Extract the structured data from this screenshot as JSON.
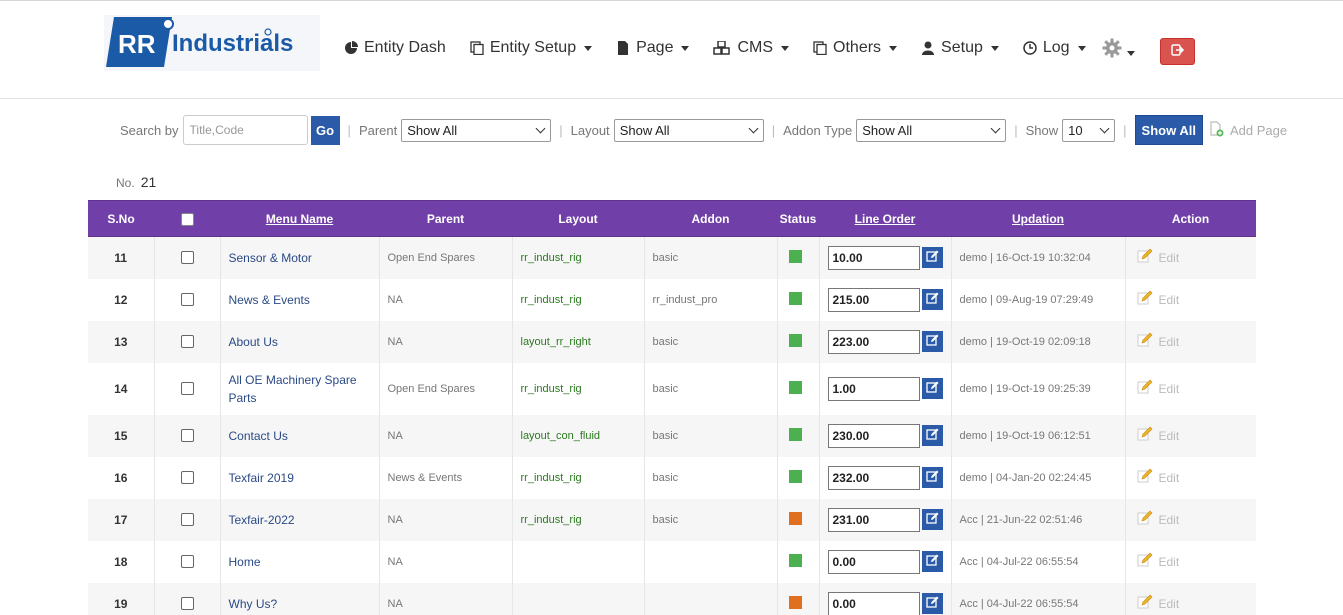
{
  "brand": {
    "logo_rr": "RR",
    "logo_text": "Industrials",
    "primary": "#1b5aa6"
  },
  "nav": [
    {
      "label": "Entity Dash",
      "icon": "pie-chart-icon",
      "caret": false
    },
    {
      "label": "Entity Setup",
      "icon": "copy-icon",
      "caret": true
    },
    {
      "label": "Page",
      "icon": "file-icon",
      "caret": true
    },
    {
      "label": "CMS",
      "icon": "cubes-icon",
      "caret": true
    },
    {
      "label": "Others",
      "icon": "copy-icon",
      "caret": true
    },
    {
      "label": "Setup",
      "icon": "user-icon",
      "caret": true
    },
    {
      "label": "Log",
      "icon": "clock-icon",
      "caret": true
    }
  ],
  "filters": {
    "search_label": "Search by",
    "search_placeholder": "Title,Code",
    "go_label": "Go",
    "parent_label": "Parent",
    "parent_value": "Show All",
    "layout_label": "Layout",
    "layout_value": "Show All",
    "addon_label": "Addon Type",
    "addon_value": "Show All",
    "show_label": "Show",
    "show_value": "10",
    "show_all_label": "Show All",
    "add_page_label": "Add Page"
  },
  "count": {
    "label": "No.",
    "value": "21"
  },
  "table": {
    "headers": {
      "sno": "S.No",
      "menu": "Menu Name",
      "parent": "Parent",
      "layout": "Layout",
      "addon": "Addon",
      "status": "Status",
      "order": "Line Order",
      "updation": "Updation",
      "action": "Action"
    },
    "edit_label": "Edit",
    "status_colors": {
      "active": "#4caf50",
      "inactive": "#e07020"
    },
    "rows": [
      {
        "sno": "11",
        "menu": "Sensor & Motor",
        "parent": "Open End Spares",
        "layout": "rr_indust_rig",
        "addon": "basic",
        "status": "active",
        "order": "10.00",
        "updation": "demo | 16-Oct-19 10:32:04"
      },
      {
        "sno": "12",
        "menu": "News & Events",
        "parent": "NA",
        "layout": "rr_indust_rig",
        "addon": "rr_indust_pro",
        "status": "active",
        "order": "215.00",
        "updation": "demo | 09-Aug-19 07:29:49"
      },
      {
        "sno": "13",
        "menu": "About Us",
        "parent": "NA",
        "layout": "layout_rr_right",
        "addon": "basic",
        "status": "active",
        "order": "223.00",
        "updation": "demo | 19-Oct-19 02:09:18"
      },
      {
        "sno": "14",
        "menu": "All OE Machinery Spare Parts",
        "parent": "Open End Spares",
        "layout": "rr_indust_rig",
        "addon": "basic",
        "status": "active",
        "order": "1.00",
        "updation": "demo | 19-Oct-19 09:25:39"
      },
      {
        "sno": "15",
        "menu": "Contact Us",
        "parent": "NA",
        "layout": "layout_con_fluid",
        "addon": "basic",
        "status": "active",
        "order": "230.00",
        "updation": "demo | 19-Oct-19 06:12:51"
      },
      {
        "sno": "16",
        "menu": "Texfair 2019",
        "parent": "News & Events",
        "layout": "rr_indust_rig",
        "addon": "basic",
        "status": "active",
        "order": "232.00",
        "updation": "demo | 04-Jan-20 02:24:45"
      },
      {
        "sno": "17",
        "menu": "Texfair-2022",
        "parent": "NA",
        "layout": "rr_indust_rig",
        "addon": "basic",
        "status": "inactive",
        "order": "231.00",
        "updation": "Acc | 21-Jun-22 02:51:46"
      },
      {
        "sno": "18",
        "menu": "Home",
        "parent": "NA",
        "layout": "",
        "addon": "",
        "status": "active",
        "order": "0.00",
        "updation": "Acc | 04-Jul-22 06:55:54"
      },
      {
        "sno": "19",
        "menu": "Why Us?",
        "parent": "NA",
        "layout": "",
        "addon": "",
        "status": "inactive",
        "order": "0.00",
        "updation": "Acc | 04-Jul-22 06:55:54"
      }
    ]
  }
}
